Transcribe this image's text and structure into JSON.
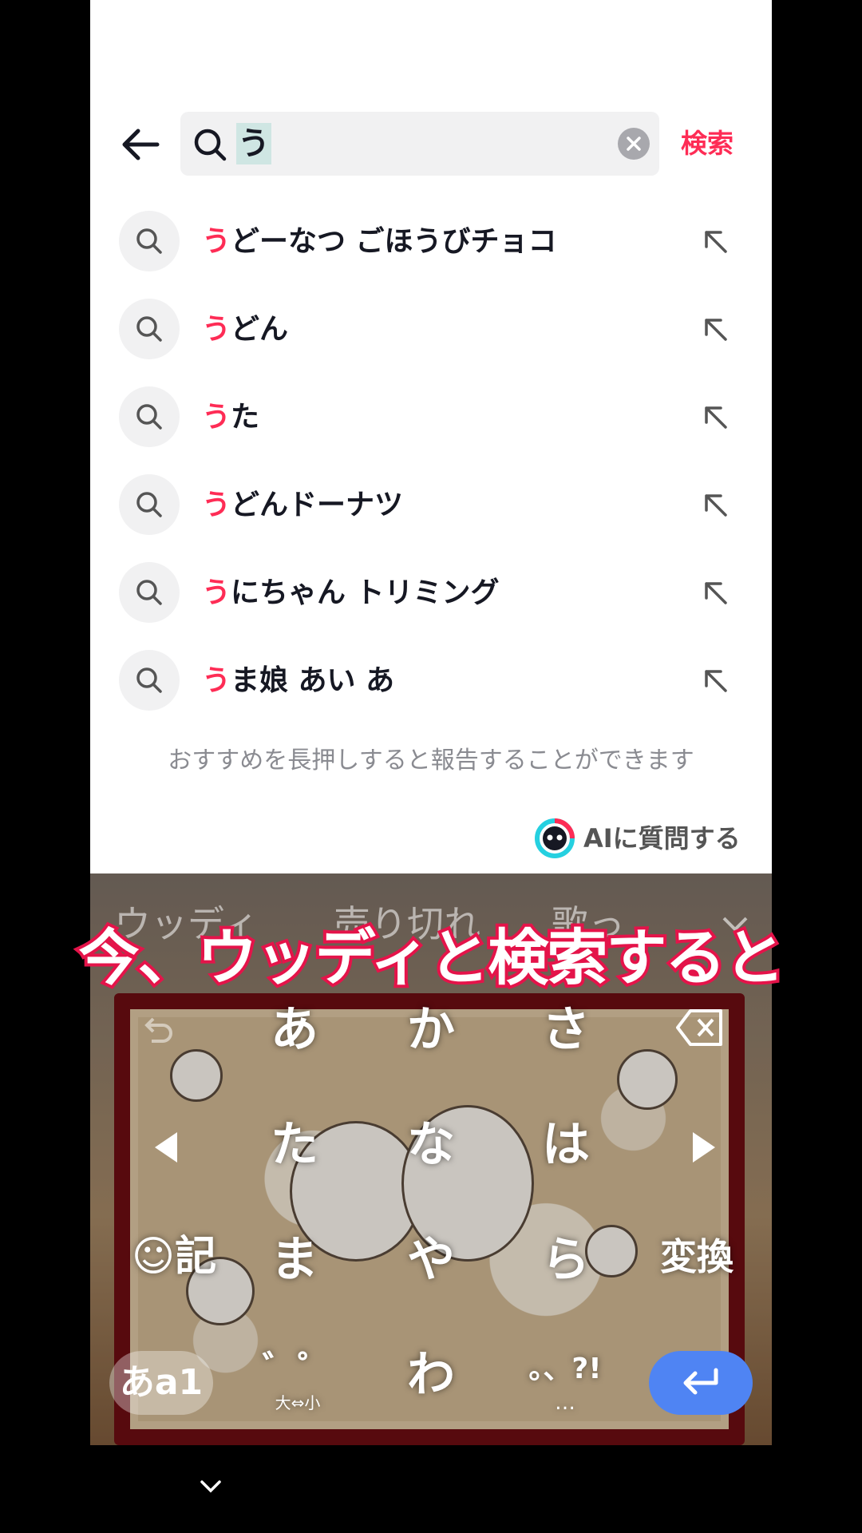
{
  "search": {
    "query": "う",
    "submit_label": "検索"
  },
  "suggestions": [
    {
      "highlight": "う",
      "rest": "どーなつ ごほうびチョコ"
    },
    {
      "highlight": "う",
      "rest": "どん"
    },
    {
      "highlight": "う",
      "rest": "た"
    },
    {
      "highlight": "う",
      "rest": "どんドーナツ"
    },
    {
      "highlight": "う",
      "rest": "にちゃん トリミング"
    },
    {
      "highlight": "う",
      "rest": "ま娘 あい あ"
    }
  ],
  "report_note": "おすすめを長押しすると報告することができます",
  "ai_button_label": "AIに質問する",
  "keyboard": {
    "candidates": [
      "ウッディ",
      "売り切れ",
      "歌っ"
    ],
    "keys_row1": [
      "あ",
      "か",
      "さ"
    ],
    "keys_row2": [
      "た",
      "な",
      "は"
    ],
    "keys_row3": [
      "ま",
      "や",
      "ら"
    ],
    "key_wa": "わ",
    "emoji_key_label": "☺記",
    "convert_label": "変換",
    "mode_label": "あa1",
    "dakuten_label": "゛゜",
    "dakuten_sub": "大⇔小",
    "punct_label": "。、?!",
    "punct_sub": "…"
  },
  "caption": "今、ウッディと検索すると",
  "colors": {
    "accent": "#fe2c55",
    "caption_stroke": "#e4144a",
    "enter_key": "#4f84f3"
  }
}
